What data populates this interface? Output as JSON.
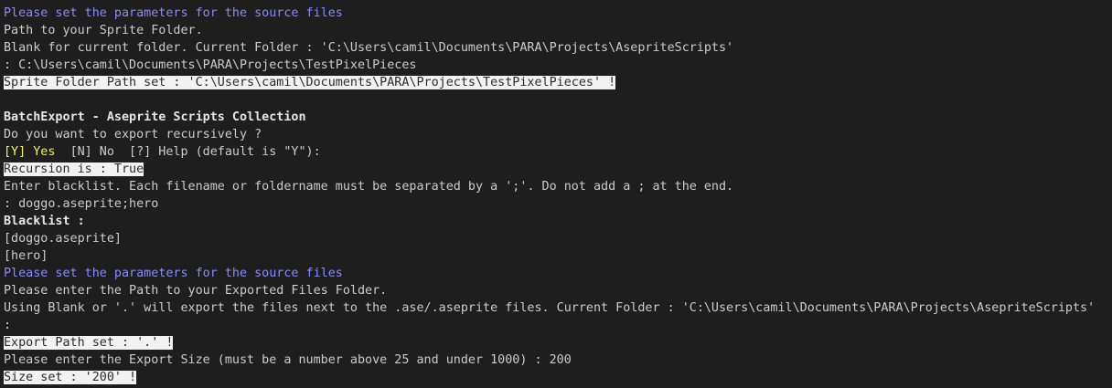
{
  "lines": [
    {
      "text": "Please set the parameters for the source files"
    },
    {
      "text": "Path to your Sprite Folder."
    },
    {
      "text": "Blank for current folder. Current Folder : 'C:\\Users\\camil\\Documents\\PARA\\Projects\\AsepriteScripts'"
    },
    {
      "text": ": C:\\Users\\camil\\Documents\\PARA\\Projects\\TestPixelPieces"
    },
    {
      "text": "Sprite Folder Path set : 'C:\\Users\\camil\\Documents\\PARA\\Projects\\TestPixelPieces' !"
    },
    {
      "text": ""
    },
    {
      "text": "BatchExport - Aseprite Scripts Collection"
    },
    {
      "text": "Do you want to export recursively ?"
    },
    {
      "yes": "[Y] Yes",
      "rest": "[N] No  [?] Help (default is \"Y\"):"
    },
    {
      "text": "Recursion is : True"
    },
    {
      "text": "Enter blacklist. Each filename or foldername must be separated by a ';'. Do not add a ; at the end."
    },
    {
      "text": ": doggo.aseprite;hero"
    },
    {
      "text": "Blacklist :"
    },
    {
      "text": "[doggo.aseprite]"
    },
    {
      "text": "[hero]"
    },
    {
      "text": "Please set the parameters for the source files"
    },
    {
      "text": "Please enter the Path to your Exported Files Folder."
    },
    {
      "text": "Using Blank or '.' will export the files next to the .ase/.aseprite files. Current Folder : 'C:\\Users\\camil\\Documents\\PARA\\Projects\\AsepriteScripts'"
    },
    {
      "text": ":"
    },
    {
      "text": "Export Path set : '.' !"
    },
    {
      "text": "Please enter the Export Size (must be a number above 25 and under 1000) : 200"
    },
    {
      "text": "Size set : '200' !"
    }
  ]
}
